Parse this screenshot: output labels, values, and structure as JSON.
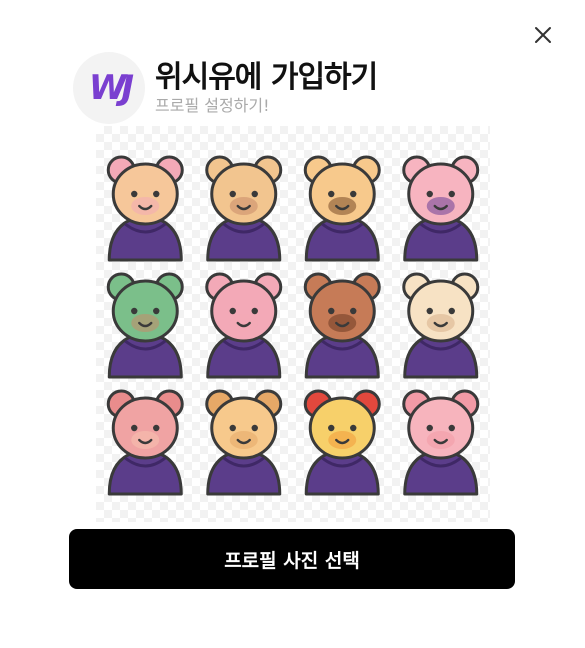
{
  "header": {
    "logo_text": "WJ",
    "title": "위시유에 가입하기",
    "subtitle": "프로필 설정하기!"
  },
  "close_icon": "close-icon",
  "avatar_grid": {
    "items": [
      {
        "name": "rat",
        "face": "#f6c79a",
        "ear": "#f3a9b7",
        "accent": "#f3a9b7"
      },
      {
        "name": "ox",
        "face": "#f2c58f",
        "ear": "#f2c58f",
        "accent": "#c98b6a"
      },
      {
        "name": "tiger",
        "face": "#f7c98c",
        "ear": "#f7c98c",
        "accent": "#7a4a28"
      },
      {
        "name": "rabbit",
        "face": "#f7b4c0",
        "ear": "#f7b4c0",
        "accent": "#6b3f96"
      },
      {
        "name": "dragon",
        "face": "#7bbf8a",
        "ear": "#7bbf8a",
        "accent": "#c98b6a"
      },
      {
        "name": "snake",
        "face": "#f3a9b7",
        "ear": "#f3a9b7",
        "accent": "#f3a9b7"
      },
      {
        "name": "horse",
        "face": "#c67b57",
        "ear": "#c67b57",
        "accent": "#6e3b22"
      },
      {
        "name": "goat",
        "face": "#f7e2c4",
        "ear": "#f7e2c4",
        "accent": "#d9b08c"
      },
      {
        "name": "monkey",
        "face": "#f0a3a3",
        "ear": "#e98c8c",
        "accent": "#f7c3b0"
      },
      {
        "name": "dog",
        "face": "#f7c98c",
        "ear": "#e6a867",
        "accent": "#e6a867"
      },
      {
        "name": "rooster",
        "face": "#f7d06a",
        "ear": "#e2483d",
        "accent": "#f29a3a"
      },
      {
        "name": "pig",
        "face": "#f7b4bd",
        "ear": "#f29aa6",
        "accent": "#f29aa6"
      }
    ],
    "robe_color": "#5b3d8a",
    "robe_shade": "#3f2866",
    "outline": "#3a3a3a"
  },
  "select_button": {
    "label": "프로필 사진 선택"
  }
}
